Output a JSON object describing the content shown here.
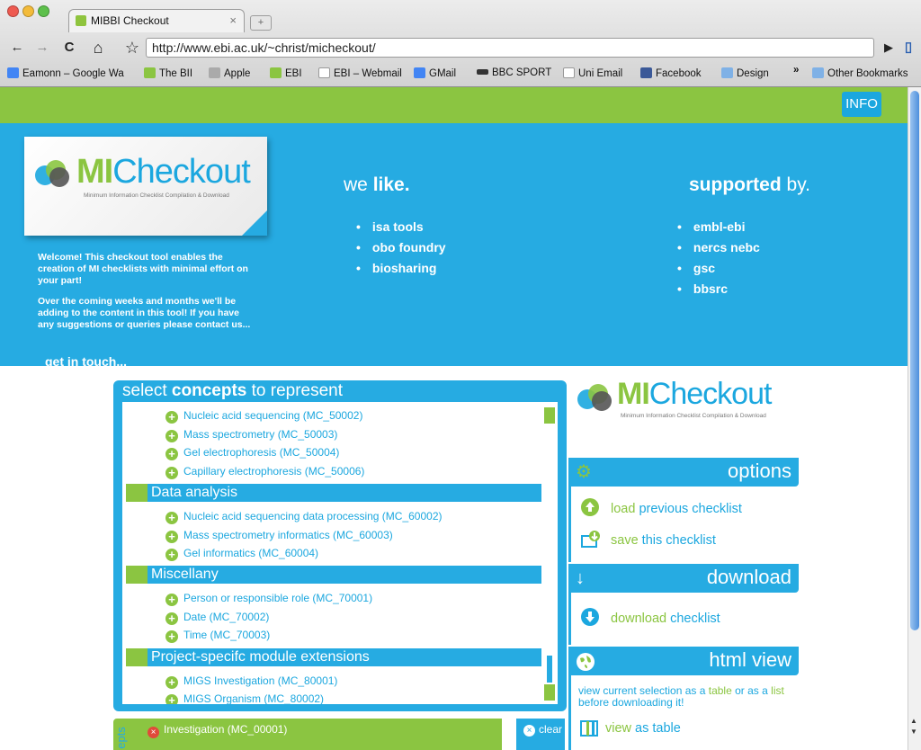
{
  "browser": {
    "tab_title": "MIBBI Checkout",
    "tab_close": "×",
    "new_tab": "+",
    "url": "http://www.ebi.ac.uk/~christ/micheckout/",
    "back": "←",
    "forward": "→",
    "reload": "C",
    "home": "⌂",
    "star": "☆",
    "go": "▶",
    "bookmarks": [
      {
        "label": "Eamonn – Google Wa",
        "icon": "google-icon",
        "color": "#4285f4"
      },
      {
        "label": "The BII",
        "icon": "page-icon",
        "color": "#8bc541"
      },
      {
        "label": "Apple",
        "icon": "apple-icon",
        "color": "#aaaaaa"
      },
      {
        "label": "EBI",
        "icon": "ebi-icon",
        "color": "#8bc541"
      },
      {
        "label": "EBI – Webmail",
        "icon": "page-icon",
        "color": "#ffffff"
      },
      {
        "label": "GMail",
        "icon": "google-icon",
        "color": "#4285f4"
      },
      {
        "label": "BBC SPORT",
        "icon": "bbc-icon",
        "color": "#333333"
      },
      {
        "label": "Uni Email",
        "icon": "page-icon",
        "color": "#ffffff"
      },
      {
        "label": "Facebook",
        "icon": "facebook-icon",
        "color": "#3b5998"
      },
      {
        "label": "Design",
        "icon": "folder-icon",
        "color": "#7fb1e6"
      }
    ],
    "more": "»",
    "other_bookmarks": "Other Bookmarks"
  },
  "header": {
    "info": "INFO",
    "logo_mi": "MI",
    "logo_checkout": "Checkout",
    "logo_sub": "Minimum Information Checklist Compilation & Download",
    "welcome_1": "Welcome! This checkout tool enables the creation of MI checklists with minimal effort on your part!",
    "welcome_2": "Over the coming weeks and months we'll be adding to the content in this tool! If you have any suggestions or queries please contact us...",
    "get_in_touch": "get in touch...",
    "likes_title_pre": "we",
    "likes_title_bold": "like.",
    "likes": [
      "isa tools",
      "obo foundry",
      "biosharing"
    ],
    "supported_title_bold": "supported",
    "supported_title_post": "by.",
    "supported": [
      "embl-ebi",
      "nercs nebc",
      "gsc",
      "bbsrc"
    ]
  },
  "concepts": {
    "title_pre": "select",
    "title_bold": "concepts",
    "title_post": "to represent",
    "items_top": [
      "Nucleic acid sequencing (MC_50002)",
      "Mass spectrometry (MC_50003)",
      "Gel electrophoresis (MC_50004)",
      "Capillary electrophoresis (MC_50006)"
    ],
    "group_data": "Data analysis",
    "items_data": [
      "Nucleic acid sequencing data processing (MC_60002)",
      "Mass spectrometry informatics (MC_60003)",
      "Gel informatics (MC_60004)"
    ],
    "group_misc": "Miscellany",
    "items_misc": [
      "Person or responsible role (MC_70001)",
      "Date (MC_70002)",
      "Time (MC_70003)"
    ],
    "group_proj": "Project-specifc module extensions",
    "items_proj": [
      "MIGS Investigation (MC_80001)",
      "MIGS Organism (MC_80002)"
    ]
  },
  "selected": {
    "side_label": "epts",
    "items": [
      "Investigation (MC_00001)"
    ],
    "clear": "clear"
  },
  "options": {
    "heading": "options",
    "load_bold": "load",
    "load_rest": "previous checklist",
    "save_bold": "save",
    "save_rest": "this checklist"
  },
  "download": {
    "heading": "download",
    "dl_bold": "download",
    "dl_rest": "checklist"
  },
  "htmlview": {
    "heading": "html view",
    "t1": "view current selection as a",
    "t2": "table",
    "t3": "or as a",
    "t4": "list",
    "t5": "before downloading it!",
    "view_bold": "view",
    "view_rest": "as table"
  },
  "colors": {
    "green": "#8bc541",
    "blue": "#26abe2"
  }
}
